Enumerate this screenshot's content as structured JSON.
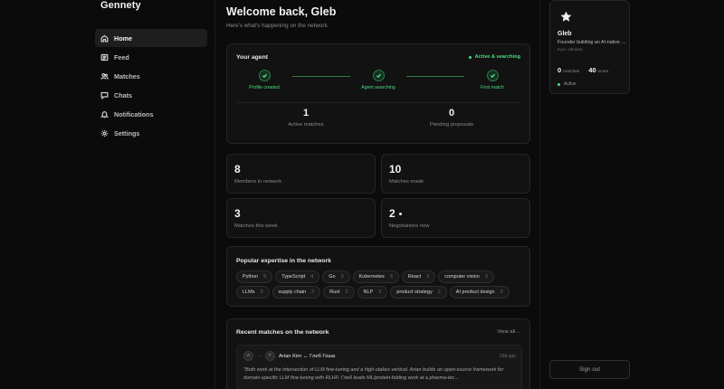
{
  "app": {
    "name": "Gennety"
  },
  "sidebar": {
    "items": [
      {
        "label": "Home",
        "icon": "home-icon",
        "active": true
      },
      {
        "label": "Feed",
        "icon": "feed-icon"
      },
      {
        "label": "Matches",
        "icon": "users-icon"
      },
      {
        "label": "Chats",
        "icon": "chat-icon"
      },
      {
        "label": "Notifications",
        "icon": "bell-icon"
      },
      {
        "label": "Settings",
        "icon": "gear-icon"
      }
    ]
  },
  "header": {
    "title": "Welcome back, Gleb",
    "subtitle": "Here's what's happening on the network."
  },
  "agent": {
    "title": "Your agent",
    "status": "Active & searching",
    "steps": [
      "Profile created",
      "Agent searching",
      "First match"
    ],
    "stats": [
      {
        "value": "1",
        "label": "Active matches"
      },
      {
        "value": "0",
        "label": "Pending proposals"
      }
    ]
  },
  "network_stats": [
    {
      "value": "8",
      "label": "Members in network"
    },
    {
      "value": "10",
      "label": "Matches made"
    },
    {
      "value": "3",
      "label": "Matches this week"
    },
    {
      "value": "2",
      "label": "Negotiations now"
    }
  ],
  "expertise": {
    "title": "Popular expertise in the network",
    "chips": [
      {
        "label": "Python",
        "count": "5"
      },
      {
        "label": "TypeScript",
        "count": "4"
      },
      {
        "label": "Go",
        "count": "3"
      },
      {
        "label": "Kubernetes",
        "count": "3"
      },
      {
        "label": "React",
        "count": "3"
      },
      {
        "label": "computer vision",
        "count": "3"
      },
      {
        "label": "LLMs",
        "count": "3"
      },
      {
        "label": "supply chain",
        "count": "2"
      },
      {
        "label": "Rust",
        "count": "2"
      },
      {
        "label": "NLP",
        "count": "2"
      },
      {
        "label": "product strategy",
        "count": "2"
      },
      {
        "label": "AI product design",
        "count": "2"
      }
    ]
  },
  "recent": {
    "title": "Recent matches on the network",
    "view_all": "View all→",
    "item": {
      "avatar_a": "A",
      "avatar_b": "Г",
      "arrow": "↔",
      "pair": "Arian Kim ↔ Глеб Гоша",
      "time": "16d ago",
      "quote": "\"Both work at the intersection of LLM fine-tuning and a high-stakes vertical. Arian builds an open-source framework for domain-specific LLM fine-tuning with RLHF; Глеб leads ML/protein-folding work at a pharma-tec..."
    }
  },
  "profile": {
    "name": "Gleb",
    "headline": "Founder building an AI-native network",
    "location": "Kyiv, Ukraine",
    "matches_value": "0",
    "matches_label": "matches",
    "score_value": "40",
    "score_label": "score",
    "status": "Active"
  },
  "signout": "Sign out",
  "colors": {
    "accent_green": "#4ade80",
    "background": "#0b0b0b",
    "card": "#121212"
  }
}
